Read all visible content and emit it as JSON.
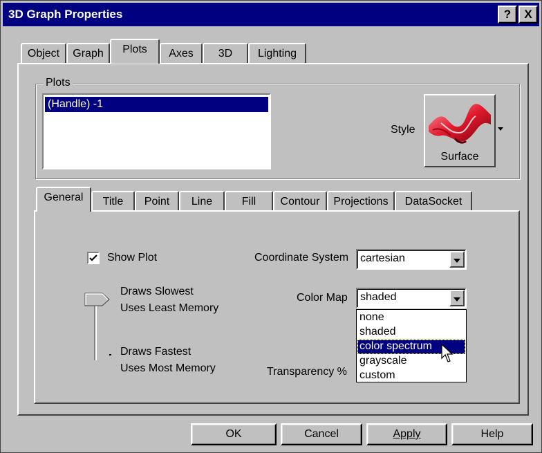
{
  "window": {
    "title": "3D Graph Properties",
    "help_glyph": "?",
    "close_glyph": "X"
  },
  "top_tabs": [
    {
      "label": "Object"
    },
    {
      "label": "Graph"
    },
    {
      "label": "Plots",
      "selected": true
    },
    {
      "label": "Axes"
    },
    {
      "label": "3D"
    },
    {
      "label": "Lighting"
    }
  ],
  "plots_group": {
    "legend": "Plots",
    "list_items": [
      {
        "label": "(Handle) -1",
        "selected": true
      }
    ],
    "style_label": "Style",
    "style_button_label": "Surface"
  },
  "sub_tabs": [
    {
      "label": "General",
      "selected": true
    },
    {
      "label": "Title"
    },
    {
      "label": "Point"
    },
    {
      "label": "Line"
    },
    {
      "label": "Fill"
    },
    {
      "label": "Contour"
    },
    {
      "label": "Projections"
    },
    {
      "label": "DataSocket"
    }
  ],
  "general": {
    "show_plot_label": "Show Plot",
    "show_plot_checked": true,
    "slider_top_line1": "Draws Slowest",
    "slider_top_line2": "Uses Least Memory",
    "slider_bottom_line1": "Draws Fastest",
    "slider_bottom_line2": "Uses Most Memory",
    "slider_value": "Draws Slowest / Uses Least Memory",
    "coordinate_system_label": "Coordinate System",
    "coordinate_system_value": "cartesian",
    "color_map_label": "Color Map",
    "color_map_value": "shaded",
    "color_map_options": [
      "none",
      "shaded",
      "color spectrum",
      "grayscale",
      "custom"
    ],
    "color_map_highlighted": "color spectrum",
    "transparency_label": "Transparency %"
  },
  "buttons": {
    "ok": "OK",
    "cancel": "Cancel",
    "apply": "Apply",
    "help": "Help"
  },
  "colors": {
    "title_bar": "#000080",
    "selection": "#000080",
    "face": "#c0c0c0"
  }
}
